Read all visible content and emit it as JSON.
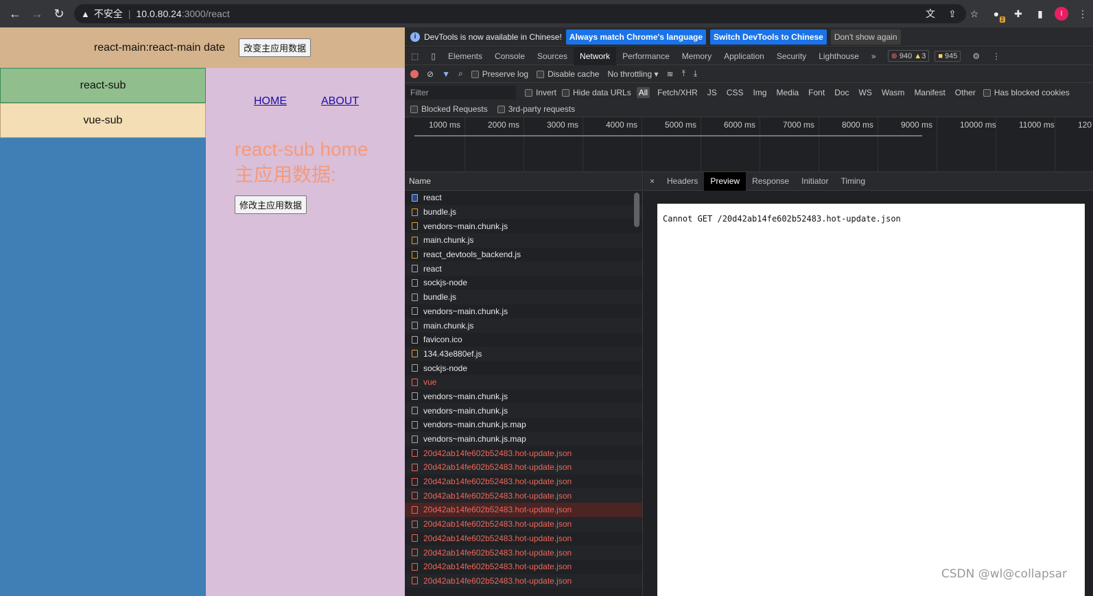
{
  "browser": {
    "security_label": "不安全",
    "url_host": "10.0.80.24",
    "url_path": ":3000/react",
    "avatar_letter": "I",
    "ext_badge": "2"
  },
  "app": {
    "header_text": "react-main:react-main date",
    "header_button": "改变主应用数据",
    "sidebar": [
      {
        "label": "react-sub"
      },
      {
        "label": "vue-sub"
      }
    ],
    "links": [
      {
        "label": "HOME"
      },
      {
        "label": "ABOUT"
      }
    ],
    "sub_title_line1": "react-sub home",
    "sub_title_line2": "主应用数据:",
    "sub_button": "修改主应用数据"
  },
  "devtools": {
    "info_text": "DevTools is now available in Chinese!",
    "info_btn1": "Always match Chrome's language",
    "info_btn2": "Switch DevTools to Chinese",
    "info_btn3": "Don't show again",
    "tabs": [
      "Elements",
      "Console",
      "Sources",
      "Network",
      "Performance",
      "Memory",
      "Application",
      "Security",
      "Lighthouse"
    ],
    "errors": "940",
    "warnings": "3",
    "issues": "945",
    "preserve_log": "Preserve log",
    "disable_cache": "Disable cache",
    "throttling": "No throttling",
    "filter_placeholder": "Filter",
    "invert": "Invert",
    "hide_data_urls": "Hide data URLs",
    "types": [
      "All",
      "Fetch/XHR",
      "JS",
      "CSS",
      "Img",
      "Media",
      "Font",
      "Doc",
      "WS",
      "Wasm",
      "Manifest",
      "Other"
    ],
    "has_blocked_cookies": "Has blocked cookies",
    "blocked_requests": "Blocked Requests",
    "third_party": "3rd-party requests",
    "timeline_ticks": [
      "1000 ms",
      "2000 ms",
      "3000 ms",
      "4000 ms",
      "5000 ms",
      "6000 ms",
      "7000 ms",
      "8000 ms",
      "9000 ms",
      "10000 ms",
      "11000 ms",
      "120"
    ],
    "name_header": "Name",
    "rows": [
      {
        "name": "react",
        "kind": "doc"
      },
      {
        "name": "bundle.js",
        "kind": "js"
      },
      {
        "name": "vendors~main.chunk.js",
        "kind": "js"
      },
      {
        "name": "main.chunk.js",
        "kind": "js"
      },
      {
        "name": "react_devtools_backend.js",
        "kind": "js"
      },
      {
        "name": "react",
        "kind": "plain"
      },
      {
        "name": "sockjs-node",
        "kind": "plain"
      },
      {
        "name": "bundle.js",
        "kind": "plain"
      },
      {
        "name": "vendors~main.chunk.js",
        "kind": "plain"
      },
      {
        "name": "main.chunk.js",
        "kind": "plain"
      },
      {
        "name": "favicon.ico",
        "kind": "plain"
      },
      {
        "name": "134.43e880ef.js",
        "kind": "js"
      },
      {
        "name": "sockjs-node",
        "kind": "plain"
      },
      {
        "name": "vue",
        "kind": "err"
      },
      {
        "name": "vendors~main.chunk.js",
        "kind": "plain"
      },
      {
        "name": "vendors~main.chunk.js",
        "kind": "plain"
      },
      {
        "name": "vendors~main.chunk.js.map",
        "kind": "plain"
      },
      {
        "name": "vendors~main.chunk.js.map",
        "kind": "plain"
      },
      {
        "name": "20d42ab14fe602b52483.hot-update.json",
        "kind": "err"
      },
      {
        "name": "20d42ab14fe602b52483.hot-update.json",
        "kind": "err"
      },
      {
        "name": "20d42ab14fe602b52483.hot-update.json",
        "kind": "err"
      },
      {
        "name": "20d42ab14fe602b52483.hot-update.json",
        "kind": "err"
      },
      {
        "name": "20d42ab14fe602b52483.hot-update.json",
        "kind": "err",
        "selected": true
      },
      {
        "name": "20d42ab14fe602b52483.hot-update.json",
        "kind": "err"
      },
      {
        "name": "20d42ab14fe602b52483.hot-update.json",
        "kind": "err"
      },
      {
        "name": "20d42ab14fe602b52483.hot-update.json",
        "kind": "err"
      },
      {
        "name": "20d42ab14fe602b52483.hot-update.json",
        "kind": "err"
      },
      {
        "name": "20d42ab14fe602b52483.hot-update.json",
        "kind": "err"
      }
    ],
    "detail_tabs": [
      "Headers",
      "Preview",
      "Response",
      "Initiator",
      "Timing"
    ],
    "preview_text": "Cannot GET /20d42ab14fe602b52483.hot-update.json"
  },
  "watermark": "CSDN @wl@collapsar"
}
